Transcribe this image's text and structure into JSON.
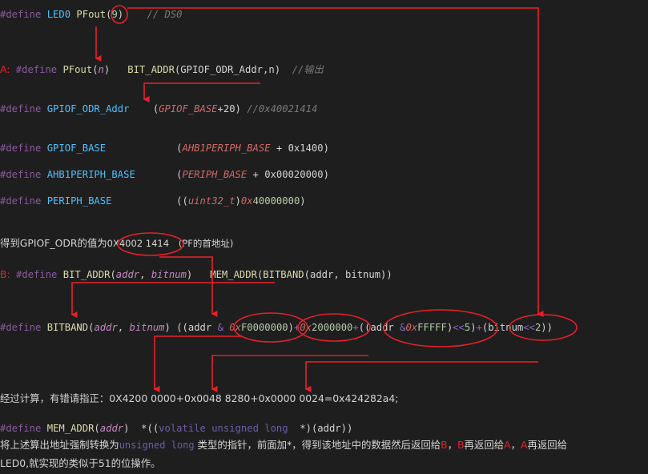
{
  "lines": {
    "l1": {
      "define": "#define",
      "name": "LED0",
      "fn": "PFout",
      "open": "(",
      "arg": "9",
      "close": ")",
      "comment": "// DS0"
    },
    "l2": {
      "marker": "A:",
      "define": "#define",
      "fn": "PFout",
      "open": "(",
      "param": "n",
      "close": ")",
      "body": "BIT_ADDR",
      "body_open": "(",
      "body_args": "GPIOF_ODR_Addr,n",
      "body_close": ")",
      "comment": "//输出"
    },
    "l3": {
      "define": "#define",
      "name": "GPIOF_ODR_Addr",
      "open": "(",
      "ref": "GPIOF_BASE",
      "rest": "+20)",
      "comment": "//0x40021414"
    },
    "l4": {
      "define": "#define",
      "name": "GPIOF_BASE",
      "open": "(",
      "ref": "AHB1PERIPH_BASE",
      "rest": " + 0x1400)"
    },
    "l5": {
      "define": "#define",
      "name": "AHB1PERIPH_BASE",
      "open": "(",
      "ref": "PERIPH_BASE",
      "rest": " + 0x00020000)"
    },
    "l6": {
      "define": "#define",
      "name": "PERIPH_BASE",
      "open": "((",
      "cast": "uint32_t",
      "castclose": ")",
      "hex": "0x",
      "hexval": "40000000",
      "close": ")"
    },
    "l7": {
      "prefix": "得到GPIOF_ODR的值为",
      "value": "0X4002 1414",
      "note": "(PF的首地址)"
    },
    "l8": {
      "marker": "B:",
      "define": "#define",
      "fn": "BIT_ADDR",
      "open": "(",
      "p1": "addr",
      "comma": ", ",
      "p2": "bitnum",
      "close": ")",
      "body": "MEM_ADDR",
      "body_open": "(",
      "inner": "BITBAND",
      "inner_args": "(addr, bitnum))"
    },
    "l9": {
      "define": "#define",
      "fn": "BITBAND",
      "open": "(",
      "p1": "addr",
      "comma": ", ",
      "p2": "bitnum",
      "close": ")",
      "s1": " ((addr ",
      "amp": "&",
      "hex1a": "0x",
      "hex1b": "F0000000",
      "s2": ")",
      "plus1": "+",
      "hex2a": "0x",
      "hex2b": "2000000",
      "plus2": "+",
      "s3": "((addr ",
      "amp2": "&",
      "hex3a": "0x",
      "hex3b": "FFFFF",
      "s4": ")",
      "shl": "<<",
      "five": "5",
      "s5": ")",
      "plus3": "+",
      "s6": "(bitnum",
      "shl2": "<<",
      "two": "2",
      "s7": "))"
    },
    "l10": {
      "text": "经过计算，有错请指正：0X4200 0000+0x0048 8280+0x0000 0024=0x424282a4;"
    },
    "l11": {
      "define": "#define",
      "fn": "MEM_ADDR",
      "open": "(",
      "param": "addr",
      "close": ")",
      "s1": "  *((",
      "volatile": "volatile",
      "sp1": " ",
      "unsigned": "unsigned",
      "sp2": " ",
      "long": "long",
      "s2": "  *)(addr))"
    },
    "l12": {
      "a": "将上述算出地址强制转换为",
      "b": "unsigned long",
      "c": " 类型的指针，前面加*，得到该地址中的数据然后返回给",
      "d": "B",
      "e": "，",
      "f": "B",
      "g": "再返回给",
      "h": "A",
      "i": "，",
      "j": "A",
      "k": "再返回给"
    },
    "l13": {
      "text": "LED0,就实现的类似于51的位操作。"
    }
  },
  "colors": {
    "annotation": "#e8202a",
    "background": "#1e1e1e"
  }
}
